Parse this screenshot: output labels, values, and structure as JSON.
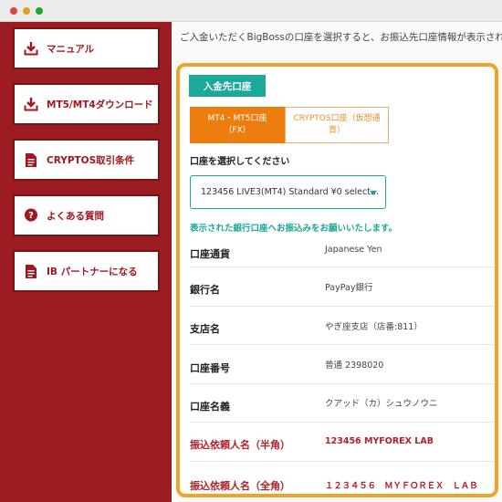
{
  "sidebar": {
    "items": [
      {
        "label": "マニュアル",
        "icon": "download-icon"
      },
      {
        "label": "MT5/MT4ダウンロード",
        "icon": "download-icon"
      },
      {
        "label": "CRYPTOS取引条件",
        "icon": "document-icon"
      },
      {
        "label": "よくある質問",
        "icon": "question-icon"
      },
      {
        "label": "IB パートナーになる",
        "icon": "document-icon"
      }
    ]
  },
  "main": {
    "intro": "ご入金いただくBigBossの口座を選択すると、お振込先口座情報が表示されます",
    "panel": {
      "title": "入金先口座",
      "tabs": [
        {
          "line1": "MT4・MT5口座",
          "line2": "（FX）"
        },
        {
          "line1": "CRYPTOS口座（仮想通",
          "line2": "貨）"
        }
      ],
      "select_label": "口座を選択してください",
      "select_value": "123456 LIVE3(MT4) Standard ¥0 select...",
      "notice": "表示された銀行口座へお振込みをお願いいたします。",
      "rows": [
        {
          "key": "口座通貨",
          "value": "Japanese Yen"
        },
        {
          "key": "銀行名",
          "value": "PayPay銀行"
        },
        {
          "key": "支店名",
          "value": "やぎ座支店（店番:811）"
        },
        {
          "key": "口座番号",
          "value": "普通 2398020"
        },
        {
          "key": "口座名義",
          "value": "クアッド（カ）シュウノウニ"
        },
        {
          "key": "振込依頼人名（半角）",
          "value": "123456 MYFOREX LAB"
        },
        {
          "key": "振込依頼人名（全角）",
          "value": "１２３４５６　ＭＹＦＯＲＥＸ　ＬＡＢ"
        }
      ]
    }
  },
  "colors": {
    "sidebar_bg": "#9b1d23",
    "accent_teal": "#1ba99a",
    "accent_orange": "#ee7d10",
    "panel_border": "#f0a329",
    "label_red": "#b0222a"
  }
}
